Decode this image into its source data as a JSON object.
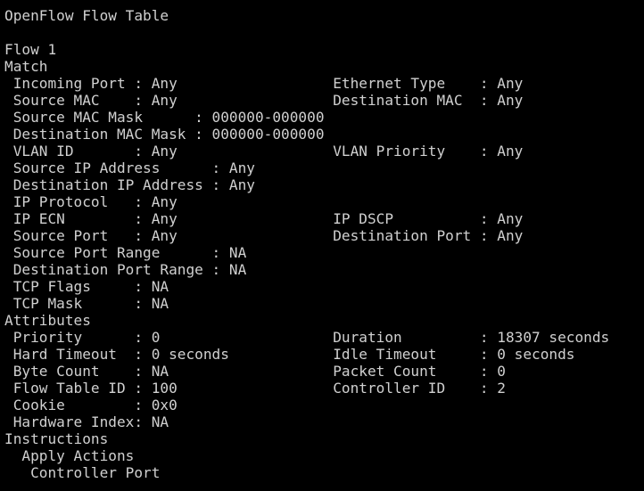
{
  "terminal": {
    "lines": [
      "OpenFlow Flow Table",
      "",
      "Flow 1",
      "Match",
      " Incoming Port : Any                  Ethernet Type    : Any",
      " Source MAC    : Any                  Destination MAC  : Any",
      " Source MAC Mask      : 000000-000000",
      " Destination MAC Mask : 000000-000000",
      " VLAN ID       : Any                  VLAN Priority    : Any",
      " Source IP Address      : Any",
      " Destination IP Address : Any",
      " IP Protocol   : Any",
      " IP ECN        : Any                  IP DSCP          : Any",
      " Source Port   : Any                  Destination Port : Any",
      " Source Port Range      : NA",
      " Destination Port Range : NA",
      " TCP Flags     : NA",
      " TCP Mask      : NA",
      "Attributes",
      " Priority      : 0                    Duration         : 18307 seconds",
      " Hard Timeout  : 0 seconds            Idle Timeout     : 0 seconds",
      " Byte Count    : NA                   Packet Count     : 0",
      " Flow Table ID : 100                  Controller ID    : 2",
      " Cookie        : 0x0",
      " Hardware Index: NA",
      "Instructions",
      "  Apply Actions",
      "   Controller Port"
    ]
  }
}
